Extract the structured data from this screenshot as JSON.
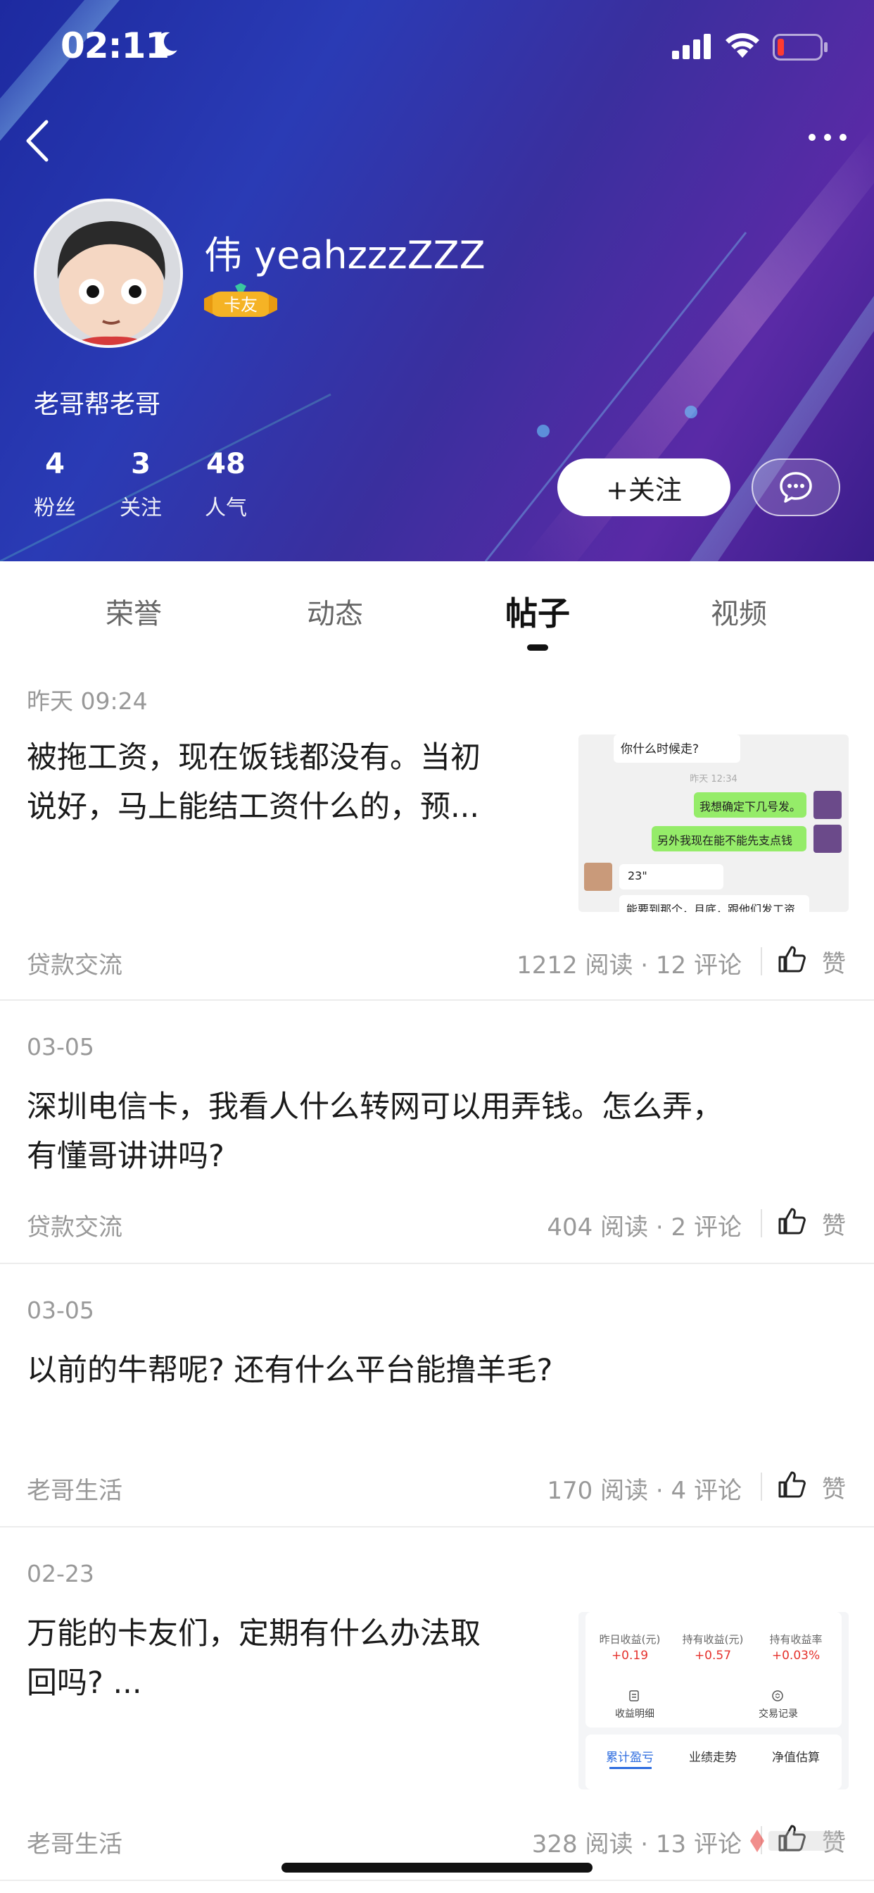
{
  "status_bar": {
    "time": "02:11"
  },
  "profile": {
    "username": "伟 yeahzzzZZZ",
    "badge": "卡友",
    "bio": "老哥帮老哥",
    "stats": [
      {
        "value": "4",
        "label": "粉丝"
      },
      {
        "value": "3",
        "label": "关注"
      },
      {
        "value": "48",
        "label": "人气"
      }
    ],
    "follow_label": "+关注"
  },
  "tabs": [
    {
      "label": "荣誉"
    },
    {
      "label": "动态"
    },
    {
      "label": "帖子",
      "active": true
    },
    {
      "label": "视频"
    }
  ],
  "posts": [
    {
      "date": "昨天 09:24",
      "title_lines": [
        "被拖工资，现在饭钱都没有。当初",
        "说好，马上能结工资什么的，预..."
      ],
      "category": "贷款交流",
      "stats": "1212 阅读 · 12 评论",
      "like_label": "赞",
      "thumbnail": {
        "type": "chat",
        "lines": [
          "你什么时候走?",
          "昨天 12:34",
          "我想确定下几号发。",
          "另外我现在能不能先支点钱",
          "23\"",
          "能要到那个，月底，跟他们发工资"
        ]
      }
    },
    {
      "date": "03-05",
      "title_lines": [
        "深圳电信卡，我看人什么转网可以用弄钱。怎么弄，",
        "有懂哥讲讲吗?"
      ],
      "category": "贷款交流",
      "stats": "404 阅读 · 2 评论",
      "like_label": "赞"
    },
    {
      "date": "03-05",
      "title_lines": [
        "以前的牛帮呢?  还有什么平台能撸羊毛?"
      ],
      "category": "老哥生活",
      "stats": "170 阅读 · 4 评论",
      "like_label": "赞"
    },
    {
      "date": "02-23",
      "title_lines": [
        "万能的卡友们，定期有什么办法取",
        "回吗? ..."
      ],
      "category": "老哥生活",
      "stats": "328 阅读 · 13 评论",
      "like_label": "赞",
      "thumbnail": {
        "type": "finance",
        "headers": [
          "昨日收益(元)",
          "持有收益(元)",
          "持有收益率"
        ],
        "values": [
          "+0.19",
          "+0.57",
          "+0.03%"
        ],
        "actions": [
          "收益明细",
          "交易记录"
        ],
        "tabs": [
          "累计盈亏",
          "业绩走势",
          "净值估算"
        ]
      }
    }
  ],
  "colors": {
    "accent_red": "#e5322d",
    "chat_green": "#95ec69"
  }
}
